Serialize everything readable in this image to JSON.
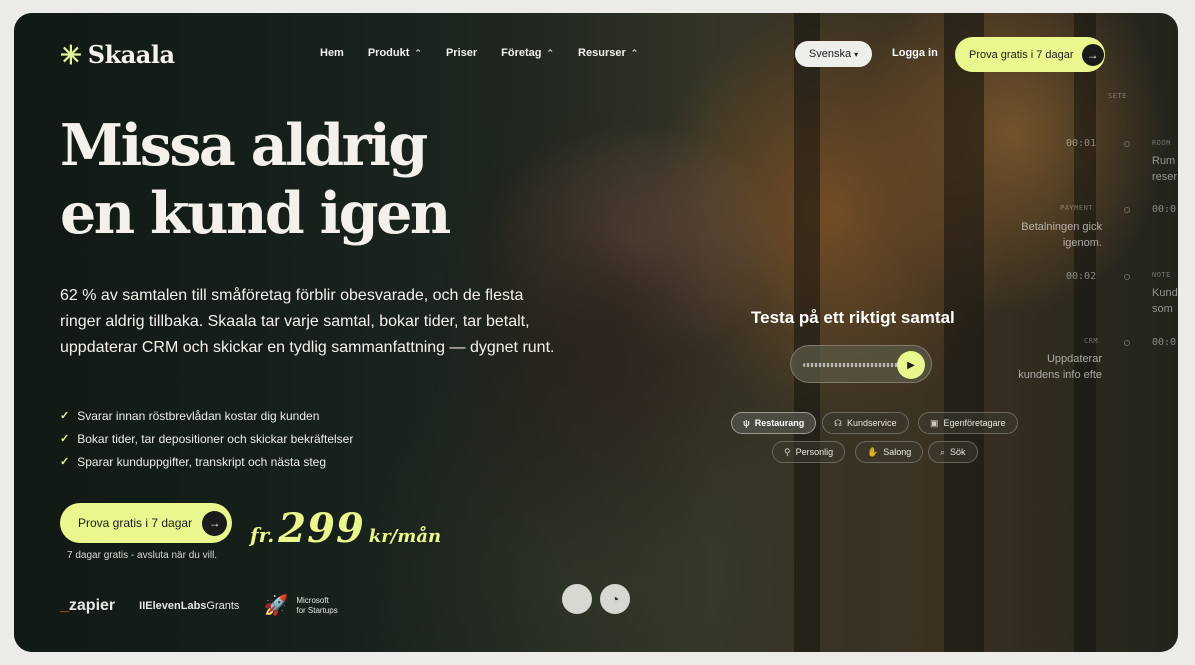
{
  "brand": {
    "name": "Skaala",
    "logo_icon": "asterisk-icon",
    "accent": "#e9f78e"
  },
  "nav": {
    "items": [
      {
        "label": "Hem",
        "has_dropdown": false
      },
      {
        "label": "Produkt",
        "has_dropdown": true
      },
      {
        "label": "Priser",
        "has_dropdown": false
      },
      {
        "label": "Företag",
        "has_dropdown": true
      },
      {
        "label": "Resurser",
        "has_dropdown": true
      }
    ],
    "language": "Svenska",
    "login": "Logga in",
    "cta": "Prova gratis i 7 dagar"
  },
  "hero": {
    "headline_line1": "Missa aldrig",
    "headline_line2": "en kund igen",
    "lead": "62 % av samtalen till småföretag förblir obesvarade, och de flesta ringer aldrig tillbaka. Skaala tar varje samtal, bokar tider, tar betalt, uppdaterar CRM och skickar en tydlig sammanfattning — dygnet runt.",
    "checks": [
      "Svarar innan röstbrevlådan kostar dig kunden",
      "Bokar tider, tar depositioner och skickar bekräftelser",
      "Sparar kunduppgifter, transkript och nästa steg"
    ],
    "cta": "Prova gratis i 7 dagar",
    "price_prefix": "fr.",
    "price_value": "299",
    "price_unit": "kr/mån",
    "trial_note": "7 dagar gratis - avsluta när du vill."
  },
  "partners": {
    "zapier": "zapier",
    "elevenlabs": "IIElevenLabs",
    "elevenlabs_suffix": "Grants",
    "microsoft_line1": "Microsoft",
    "microsoft_line2": "for Startups"
  },
  "platforms": [
    "apple-icon",
    "android-icon"
  ],
  "demo": {
    "title": "Testa på ett riktigt samtal",
    "chips": [
      {
        "label": "Restaurang",
        "icon": "utensils-icon",
        "active": true
      },
      {
        "label": "Kundservice",
        "icon": "headset-icon",
        "active": false
      },
      {
        "label": "Egenföretagare",
        "icon": "briefcase-icon",
        "active": false
      },
      {
        "label": "Personlig",
        "icon": "person-icon",
        "active": false
      },
      {
        "label": "Salong",
        "icon": "hand-icon",
        "active": false
      },
      {
        "label": "Sök",
        "icon": "search-icon",
        "active": false
      }
    ]
  },
  "timeline": {
    "t1": "00:01",
    "room_tag": "ROOM",
    "room_text_1": "Rum",
    "room_text_2": "reser",
    "payment_tag": "PAYMENT",
    "payment_text_1": "Betalningen gick",
    "payment_text_2": "igenom.",
    "t_right_1": "00:0",
    "t2": "00:02",
    "note_tag": "NOTE",
    "note_text_1": "Kund",
    "note_text_2": "som",
    "crm_tag": "CRM",
    "crm_text_1": "Uppdaterar",
    "crm_text_2": "kundens info efte",
    "t_right_2": "00:0",
    "extra_tag": "SETE"
  }
}
